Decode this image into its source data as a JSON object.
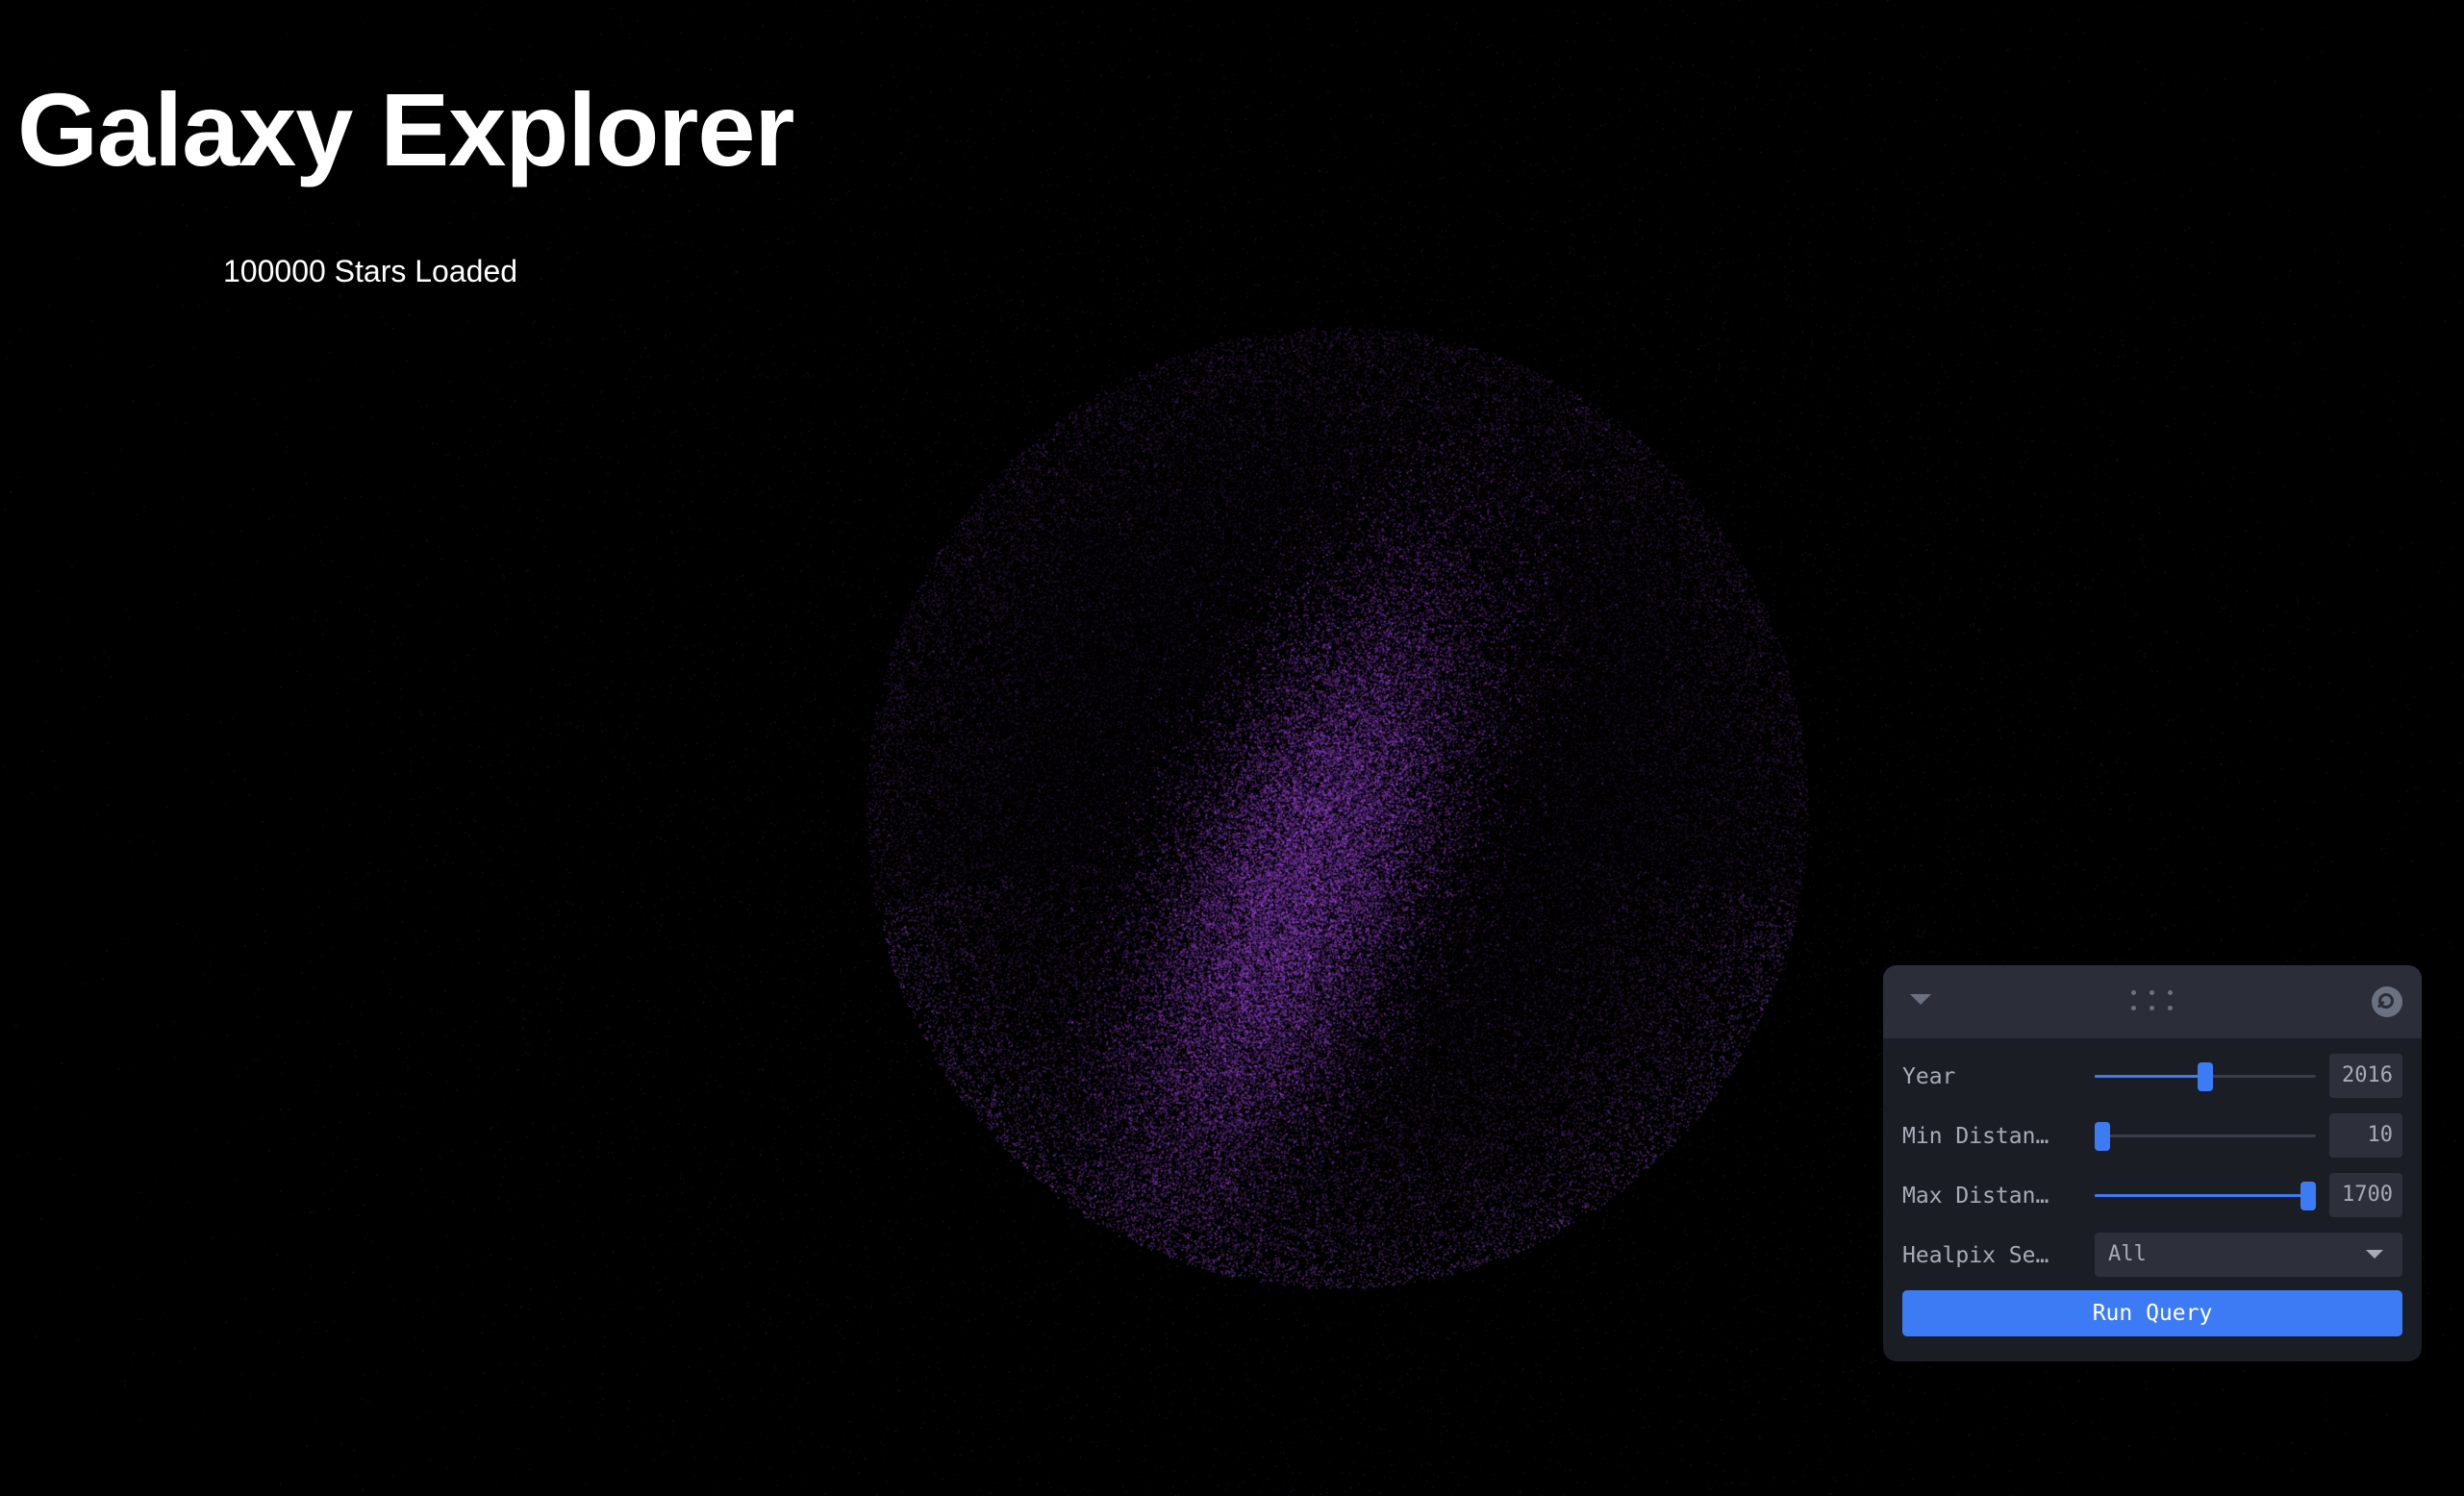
{
  "page": {
    "title": "Galaxy Explorer",
    "status": "100000 Stars Loaded"
  },
  "colors": {
    "background": "#000000",
    "stars": "#9b59d6",
    "accent": "#3d7bf5",
    "panel": "#1b1d24",
    "panel_header": "#2b2e38"
  },
  "panel": {
    "icons": {
      "collapse": "chevron-down-icon",
      "drag": "drag-handle-icon",
      "search": "search-icon"
    },
    "controls": [
      {
        "label": "Year",
        "value": "2016",
        "fraction": 0.5
      },
      {
        "label": "Min Distan…",
        "value": "10",
        "fraction": 0.0
      },
      {
        "label": "Max Distan…",
        "value": "1700",
        "fraction": 1.0
      }
    ],
    "healpix": {
      "label": "Healpix Se…",
      "selected": "All"
    },
    "run_button": "Run Query"
  }
}
